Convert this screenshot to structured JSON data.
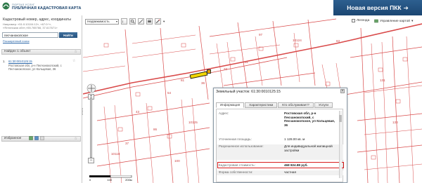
{
  "header": {
    "logo_small": "ПОРТАЛ УСЛУГ",
    "logo_big": "ПУБЛИЧНАЯ КАДАСТРОВАЯ КАРТА",
    "new_version": "Новая версия ПКК",
    "new_version_arrow": "➔"
  },
  "sidebar": {
    "title": "Кадастровый номер, адрес, координаты",
    "examples": [
      "Например: «51:0:10104:12», «67:0:*»,",
      "«Ялтинская обл»,«55.765766, 37.617671»"
    ],
    "search": {
      "value": "песчанокопское",
      "button": "Найти"
    },
    "advanced_search": "Расширенный поиск",
    "results_header": "Найден 1 объект",
    "results": [
      {
        "num": "1.",
        "cad_number": "61:30:0010125:15",
        "address": "Ростовская обл, р-н Песчанокопский, с Песчанокопское, ул Кольцевая, 36"
      }
    ],
    "favorites_label": "Избранное",
    "collapse_glyph": "‹"
  },
  "map": {
    "layer_select": "Недвижимость",
    "legend_label": "Легенда",
    "layers_label": "Управление картой",
    "scale_labels": [
      "0",
      "100",
      "200м"
    ],
    "zoom_plus": "+",
    "zoom_minus": "−",
    "labels": [
      "10124",
      "10125",
      "10118",
      "81",
      "54",
      "43",
      "86",
      "63",
      "33",
      "31",
      "131",
      "37",
      "100",
      "133",
      "97",
      "36"
    ]
  },
  "popup": {
    "title": "Земельный участок: 61:30:0010125:15",
    "close": "×",
    "tabs": [
      "Информация",
      "Характеристики",
      "Кто обслуживает?",
      "Услуги"
    ],
    "active_tab": 0,
    "rows": [
      {
        "key": "Адрес:",
        "value": "Ростовская обл, р-н Песчанокопский, с Песчанокопское, ул Кольцевая, 36",
        "bold": true
      },
      {
        "key": "Уточненная площадь:",
        "value": "1 128.00 кв. м",
        "bold": false
      },
      {
        "key": "Разрешенное использование:",
        "value": "Для индивидуальной жилищной застройки",
        "bold": false
      },
      {
        "key": "Кадастровая стоимость:",
        "value": "468 824.88 руб.",
        "bold": true
      },
      {
        "key": "Форма собственности:",
        "value": "частная",
        "bold": false
      }
    ]
  },
  "colors": {
    "brand": "#1b4672",
    "highlight": "#f2d600",
    "road": "#d94a4a",
    "popup_border_highlight": "#d81c1c"
  }
}
